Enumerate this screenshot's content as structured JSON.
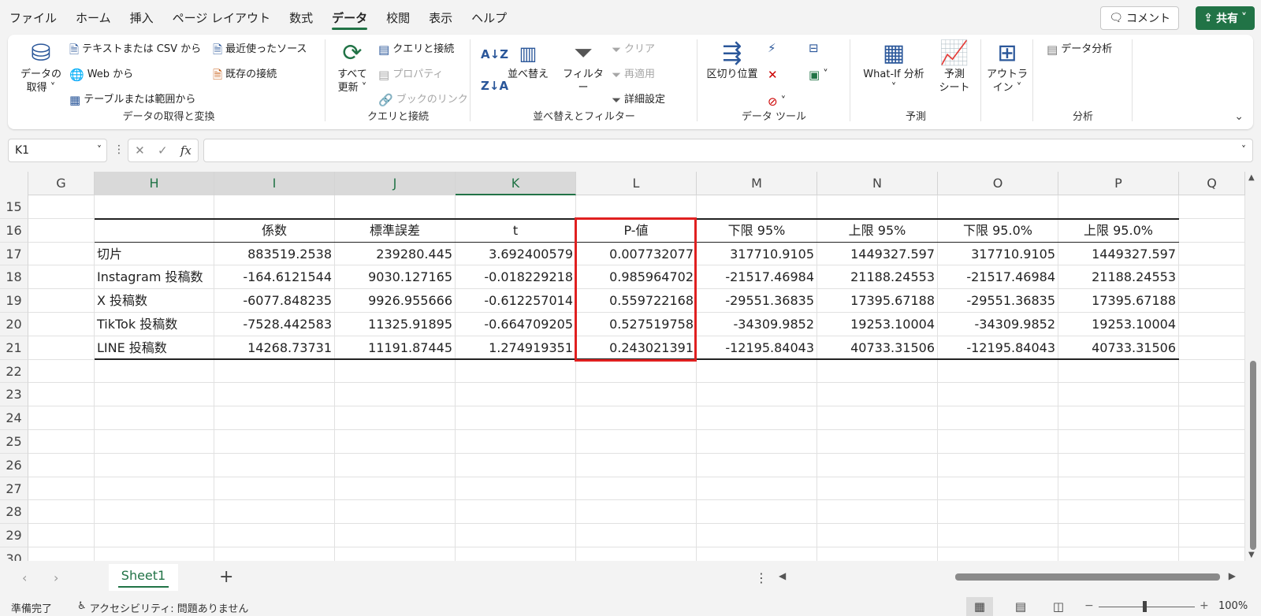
{
  "menu": {
    "tabs": [
      "ファイル",
      "ホーム",
      "挿入",
      "ページ レイアウト",
      "数式",
      "データ",
      "校閲",
      "表示",
      "ヘルプ"
    ],
    "active": "データ",
    "comment_label": "コメント",
    "share_label": "共有"
  },
  "ribbon": {
    "get_transform": {
      "label": "データの取得と変換",
      "get_data": "データの\n取得 ˅",
      "text_csv": "テキストまたは CSV から",
      "web": "Web から",
      "table_range": "テーブルまたは範囲から",
      "recent_sources": "最近使ったソース",
      "existing_connections": "既存の接続"
    },
    "queries": {
      "label": "クエリと接続",
      "refresh_all": "すべて\n更新 ˅",
      "queries_connections": "クエリと接続",
      "properties": "プロパティ",
      "book_links": "ブックのリンク"
    },
    "sort_filter": {
      "label": "並べ替えとフィルター",
      "sort": "並べ替え",
      "filter": "フィルター",
      "clear": "クリア",
      "reapply": "再適用",
      "advanced": "詳細設定"
    },
    "data_tools": {
      "label": "データ ツール",
      "text_to_columns": "区切り位置"
    },
    "forecast": {
      "label": "予測",
      "what_if": "What-If 分析\n˅",
      "forecast_sheet": "予測\nシート"
    },
    "outline": {
      "label": "アウトライン ˅",
      "outline_btn": "アウトラ\nイン ˅"
    },
    "analysis": {
      "label": "分析",
      "data_analysis": "データ分析"
    }
  },
  "formula_bar": {
    "name_box": "K1",
    "formula": ""
  },
  "columns": [
    "G",
    "H",
    "I",
    "J",
    "K",
    "L",
    "M",
    "N",
    "O",
    "P",
    "Q"
  ],
  "selected_columns": [
    "H",
    "I",
    "J",
    "K"
  ],
  "rows": [
    "15",
    "16",
    "17",
    "18",
    "19",
    "20",
    "21",
    "22",
    "23",
    "24",
    "25",
    "26",
    "27",
    "28",
    "29",
    "30"
  ],
  "table": {
    "headers": [
      "",
      "係数",
      "標準誤差",
      "t",
      "P-値",
      "下限 95%",
      "上限 95%",
      "下限 95.0%",
      "上限 95.0%"
    ],
    "rows": [
      [
        "切片",
        "883519.2538",
        "239280.445",
        "3.692400579",
        "0.007732077",
        "317710.9105",
        "1449327.597",
        "317710.9105",
        "1449327.597"
      ],
      [
        "Instagram 投稿数",
        "-164.6121544",
        "9030.127165",
        "-0.018229218",
        "0.985964702",
        "-21517.46984",
        "21188.24553",
        "-21517.46984",
        "21188.24553"
      ],
      [
        "X 投稿数",
        "-6077.848235",
        "9926.955666",
        "-0.612257014",
        "0.559722168",
        "-29551.36835",
        "17395.67188",
        "-29551.36835",
        "17395.67188"
      ],
      [
        "TikTok 投稿数",
        "-7528.442583",
        "11325.91895",
        "-0.664709205",
        "0.527519758",
        "-34309.9852",
        "19253.10004",
        "-34309.9852",
        "19253.10004"
      ],
      [
        "LINE 投稿数",
        "14268.73731",
        "11191.87445",
        "1.274919351",
        "0.243021391",
        "-12195.84043",
        "40733.31506",
        "-12195.84043",
        "40733.31506"
      ]
    ]
  },
  "highlight_color": "#e02020",
  "sheet": {
    "tab": "Sheet1"
  },
  "status": {
    "ready": "準備完了",
    "accessibility": "アクセシビリティ: 問題ありません",
    "zoom": "100%"
  },
  "colors": {
    "accent": "#217346"
  }
}
